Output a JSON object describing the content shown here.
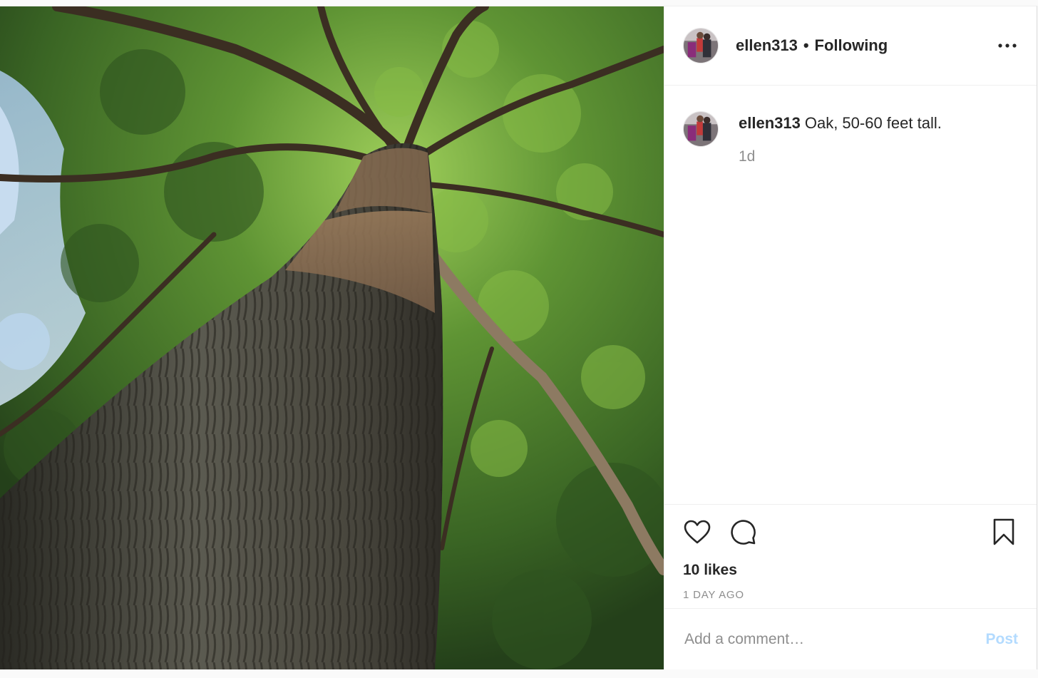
{
  "post": {
    "photo_icon": "oak-tree-photo",
    "header": {
      "username": "ellen313",
      "separator": "•",
      "follow_status": "Following",
      "more_icon": "more-options-icon"
    },
    "caption": {
      "username": "ellen313",
      "text": "Oak, 50-60 feet tall.",
      "time": "1d"
    },
    "actions": {
      "like_icon": "heart-icon",
      "comment_icon": "comment-icon",
      "save_icon": "bookmark-icon"
    },
    "likes": "10 likes",
    "posted_ago": "1 DAY AGO",
    "comment_input": {
      "placeholder": "Add a comment…",
      "value": ""
    },
    "post_button": "Post",
    "colors": {
      "text": "#262626",
      "muted": "#8e8e8e",
      "post_button_disabled": "#b3dbff",
      "border": "#efefef"
    }
  }
}
